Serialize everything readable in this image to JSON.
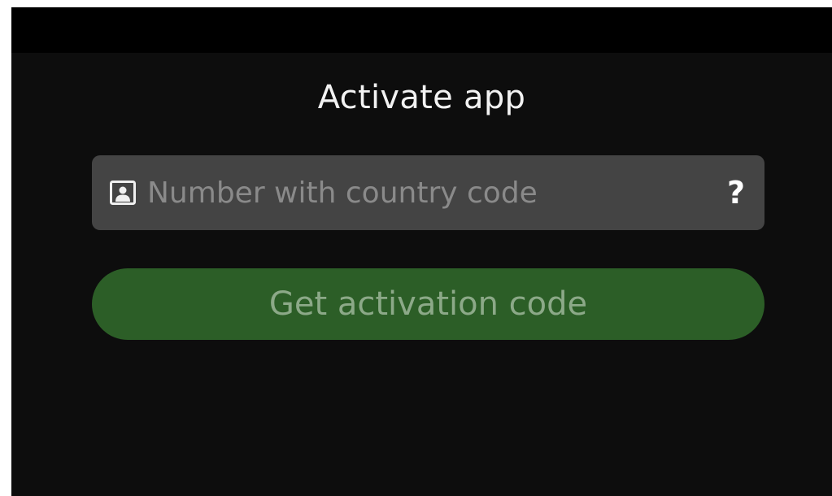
{
  "screen": {
    "title": "Activate app"
  },
  "phone": {
    "icon": "contact-card-icon",
    "placeholder": "Number with country code",
    "value": "",
    "help_label": "?"
  },
  "activate": {
    "label": "Get activation code",
    "enabled": false
  },
  "colors": {
    "background": "#0d0d0d",
    "status_bar": "#000000",
    "field_background": "#444444",
    "button_background": "#2c5e27",
    "button_text_disabled": "#8ca988"
  }
}
